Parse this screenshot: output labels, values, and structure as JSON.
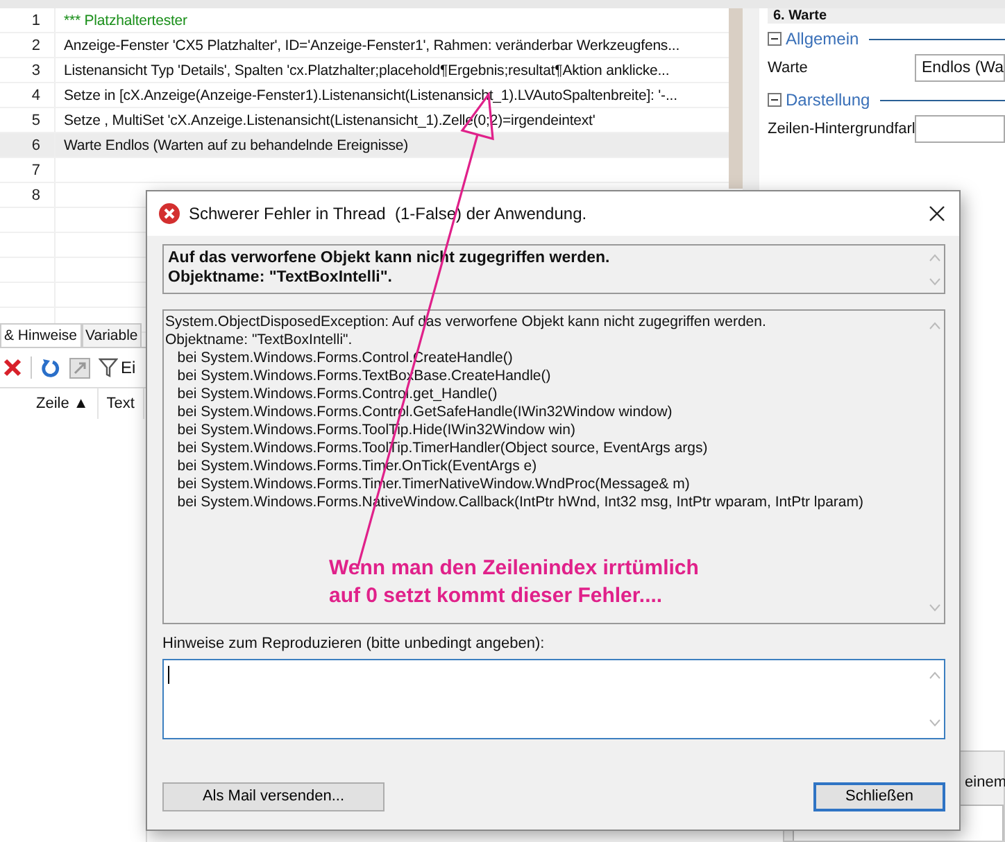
{
  "editor": {
    "lines": [
      {
        "number": "1",
        "text": "*** Platzhaltertester",
        "kind": "comment",
        "selected": false
      },
      {
        "number": "2",
        "text": "Anzeige-Fenster 'CX5 Platzhalter', ID='Anzeige-Fenster1', Rahmen: veränderbar Werkzeugfens...",
        "kind": "code",
        "selected": false
      },
      {
        "number": "3",
        "text": "Listenansicht Typ 'Details', Spalten 'cx.Platzhalter;placehold¶Ergebnis;resultat¶Aktion anklicke...",
        "kind": "code",
        "selected": false
      },
      {
        "number": "4",
        "text": "Setze in [cX.Anzeige(Anzeige-Fenster1).Listenansicht(Listenansicht_1).LVAutoSpaltenbreite]: '-...",
        "kind": "code",
        "selected": false
      },
      {
        "number": "5",
        "text": "Setze , MultiSet 'cX.Anzeige.Listenansicht(Listenansicht_1).Zelle(0;2)=irgendeintext'",
        "kind": "code",
        "selected": false
      },
      {
        "number": "6",
        "text": "Warte Endlos (Warten auf zu behandelnde Ereignisse)",
        "kind": "code",
        "selected": true
      },
      {
        "number": "7",
        "selected": false
      },
      {
        "number": "8",
        "selected": false
      }
    ]
  },
  "properties": {
    "header": "6. Warte",
    "groups": [
      {
        "title": "Allgemein",
        "expanded": true,
        "fields": [
          {
            "label": "Warte",
            "value": "Endlos (Wa"
          }
        ]
      },
      {
        "title": "Darstellung",
        "expanded": true,
        "fields": [
          {
            "label": "Zeilen-Hintergrundfarl"
          }
        ]
      }
    ]
  },
  "bottom_panel": {
    "tabs": [
      {
        "label": "& Hinweise",
        "selected": true
      },
      {
        "label": "Variable",
        "selected": false
      }
    ],
    "filter_label": "Ei",
    "columns": [
      "Zeile ▲",
      "Text"
    ]
  },
  "background_snippet": "einem",
  "dialog": {
    "title": "Schwerer Fehler in Thread  (1-False) der Anwendung.",
    "message_lines": [
      "Auf das verworfene Objekt kann nicht zugegriffen werden.",
      "Objektname: \"TextBoxIntelli\"."
    ],
    "details_lines": [
      "System.ObjectDisposedException: Auf das verworfene Objekt kann nicht zugegriffen werden.",
      "Objektname: \"TextBoxIntelli\".",
      "   bei System.Windows.Forms.Control.CreateHandle()",
      "   bei System.Windows.Forms.TextBoxBase.CreateHandle()",
      "   bei System.Windows.Forms.Control.get_Handle()",
      "   bei System.Windows.Forms.Control.GetSafeHandle(IWin32Window window)",
      "   bei System.Windows.Forms.ToolTip.Hide(IWin32Window win)",
      "   bei System.Windows.Forms.ToolTip.TimerHandler(Object source, EventArgs args)",
      "   bei System.Windows.Forms.Timer.OnTick(EventArgs e)",
      "   bei System.Windows.Forms.Timer.TimerNativeWindow.WndProc(Message& m)",
      "   bei System.Windows.Forms.NativeWindow.Callback(IntPtr hWnd, Int32 msg, IntPtr wparam, IntPtr lparam)"
    ],
    "notes_label": "Hinweise zum Reproduzieren (bitte unbedingt angeben):",
    "buttons": [
      {
        "label": "Als Mail versenden...",
        "default": false
      },
      {
        "label": "Schließen",
        "default": true
      }
    ]
  },
  "annotation": {
    "lines": [
      "Wenn man den Zeilenindex irrtümlich",
      "auf 0 setzt kommt dieser Fehler...."
    ]
  }
}
